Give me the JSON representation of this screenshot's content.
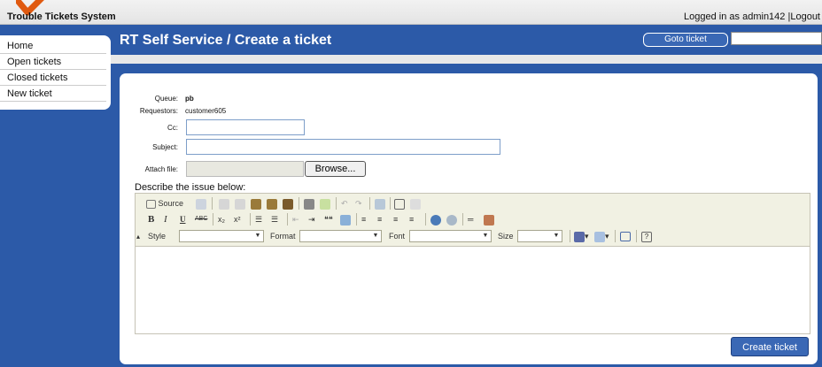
{
  "app": {
    "system_title": "Trouble Tickets System",
    "login_text": "Logged in as admin142",
    "logout_label": "Logout",
    "separator": "|"
  },
  "sidebar": {
    "items": [
      {
        "label": "Home"
      },
      {
        "label": "Open tickets"
      },
      {
        "label": "Closed tickets"
      },
      {
        "label": "New ticket"
      }
    ]
  },
  "header": {
    "title": "RT Self Service / Create a ticket",
    "goto_button": "Goto ticket",
    "goto_input_value": ""
  },
  "form": {
    "queue_label": "Queue:",
    "queue_value": "pb",
    "requestors_label": "Requestors:",
    "requestors_value": "customer605",
    "cc_label": "Cc:",
    "cc_value": "",
    "subject_label": "Subject:",
    "subject_value": "",
    "attach_label": "Attach file:",
    "browse_label": "Browse...",
    "describe_label": "Describe the issue below:",
    "submit_label": "Create ticket"
  },
  "editor": {
    "source_label": "Source",
    "style_label": "Style",
    "format_label": "Format",
    "font_label": "Font",
    "size_label": "Size",
    "bold": "B",
    "italic": "I",
    "underline": "U",
    "strike": "ABC",
    "sub": "x₂",
    "sup": "x²",
    "quote": "❝❝",
    "help": "?"
  },
  "colors": {
    "background": "#2c5aa8",
    "accent_button": "#3a68b5",
    "logo": "#e05a10"
  }
}
